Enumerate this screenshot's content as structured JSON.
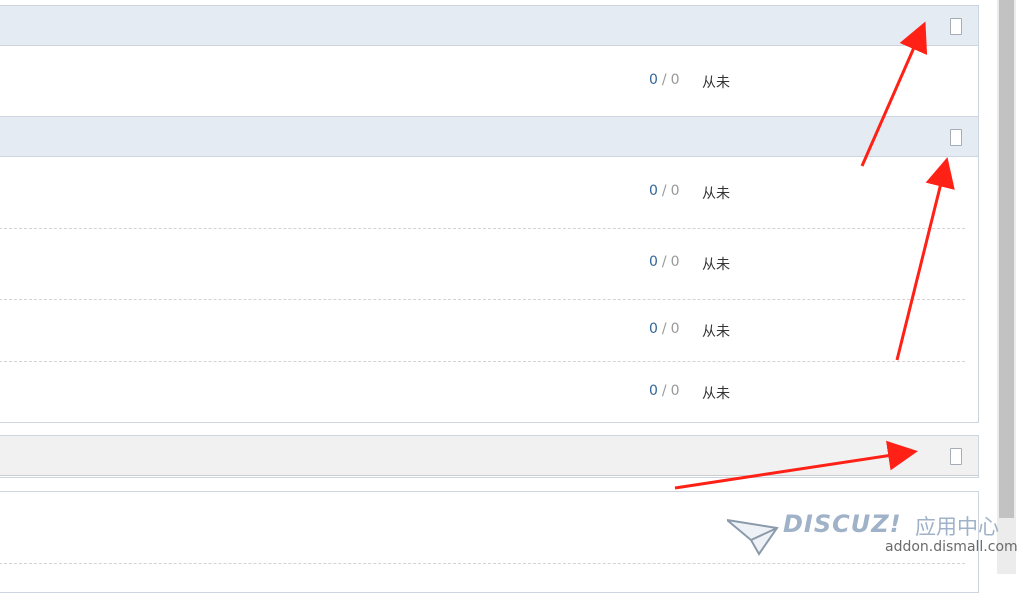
{
  "groups": [
    {
      "rows": [
        {
          "posts": "0",
          "sep": "/",
          "views": "0",
          "last": "从未"
        }
      ]
    },
    {
      "rows": [
        {
          "posts": "0",
          "sep": "/",
          "views": "0",
          "last": "从未"
        },
        {
          "posts": "0",
          "sep": "/",
          "views": "0",
          "last": "从未"
        },
        {
          "posts": "0",
          "sep": "/",
          "views": "0",
          "last": "从未"
        },
        {
          "posts": "0",
          "sep": "/",
          "views": "0",
          "last": "从未"
        }
      ]
    }
  ],
  "watermark": {
    "logo": "DISCUZ!",
    "cn": "应用中心",
    "url": "addon.dismall.com"
  },
  "colors": {
    "header": "#e4ebf2",
    "header_gray": "#f1f1f1",
    "arrow": "#ff2016",
    "link": "#336699"
  }
}
